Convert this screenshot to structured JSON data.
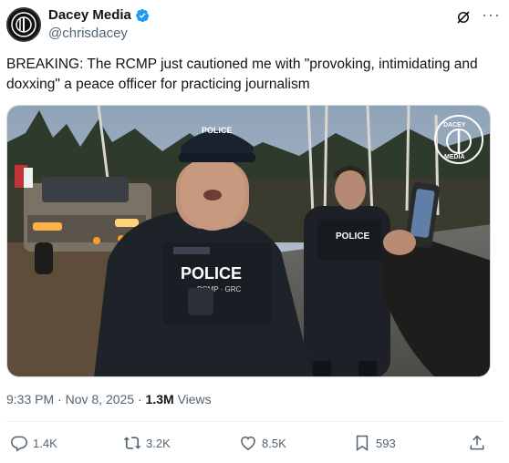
{
  "author": {
    "display_name": "Dacey Media",
    "handle": "@chrisdacey"
  },
  "tweet": {
    "text": "BREAKING: The RCMP just cautioned me with \"provoking, intimidating and doxxing\" a peace officer for practicing journalism"
  },
  "media": {
    "watermark_top": "DACEY",
    "watermark_bottom": "MEDIA",
    "vest_label_left": "POLICE",
    "vest_sub_left": "RCMP · GRC",
    "hat_label": "POLICE",
    "vest_label_right": "POLICE"
  },
  "meta": {
    "time": "9:33 PM",
    "separator_1": "·",
    "date": "Nov 8, 2025",
    "separator_2": "·",
    "views_count": "1.3M",
    "views_label": "Views"
  },
  "actions": {
    "replies": "1.4K",
    "reposts": "3.2K",
    "likes": "8.5K",
    "bookmarks": "593"
  },
  "colors": {
    "text": "#0f1419",
    "secondary": "#536471",
    "verified": "#1d9bf0",
    "divider": "#eff3f4"
  }
}
